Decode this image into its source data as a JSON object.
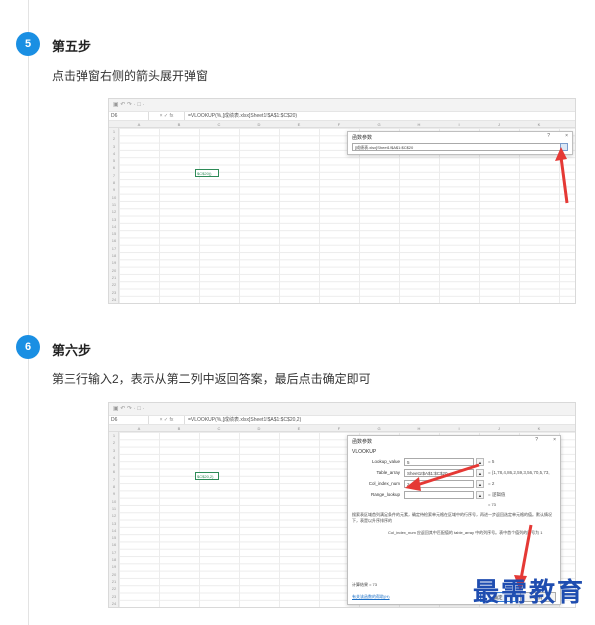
{
  "steps": [
    {
      "number": "5",
      "title": "第五步",
      "desc": "点击弹窗右侧的箭头展开弹窗"
    },
    {
      "number": "6",
      "title": "第六步",
      "desc": "第三行输入2，表示从第二列中返回答案，最后点击确定即可"
    }
  ],
  "shot1": {
    "qat": "▣ ↶ ↷ · □ ·",
    "name_box": "D6",
    "fx": "×  ✓  fx",
    "formula": "=VLOOKUP(%,[成绩表.xlsx]Sheet1!$A$1:$C$20)",
    "columns": [
      "A",
      "B",
      "C",
      "D",
      "E",
      "F",
      "G",
      "H",
      "I",
      "J",
      "K"
    ],
    "cell_ref": "$C$20))",
    "dialog_title": "函数参数",
    "dialog_help": "?",
    "dialog_close": "×",
    "dialog_input": "[成绩表.xlsx]Sheet1!$A$1:$C$20"
  },
  "shot2": {
    "qat": "▣ ↶ ↷ · □ ·",
    "name_box": "D6",
    "fx": "×  ✓  fx",
    "formula": "=VLOOKUP(%,[成绩表.xlsx]Sheet1!$A$1:$C$20,2)",
    "columns": [
      "A",
      "B",
      "C",
      "D",
      "E",
      "F",
      "G",
      "H",
      "I",
      "J",
      "K"
    ],
    "cell_ref": "$C$20,2)",
    "dialog_title": "函数参数",
    "dialog_help": "?",
    "dialog_close": "×",
    "function_name": "VLOOKUP",
    "args": [
      {
        "label": "Lookup_value",
        "value": "5",
        "result": "= 5"
      },
      {
        "label": "Table_array",
        "value": "Sheet1!$A$1:$C$20",
        "result": "= {1,78,4,86,2,59,3,56,70,5,73,"
      },
      {
        "label": "Col_index_num",
        "value": "2",
        "result": "= 2"
      },
      {
        "label": "Range_lookup",
        "value": "",
        "result": "= 逻辑值"
      }
    ],
    "result_line": "= 73",
    "description": "搜索表区域首列满足条件的元素，确定待检索单元格在区域中的行序号，再进一步返回选定单元格的值。默认情况下，表是以升序排序的",
    "arg_help": "Col_index_num  应返回其中匹配值的 table_array 中的列序号。表中首个值列的序号为 1",
    "calc_result": "计算结果 = 73",
    "help_link": "有关该函数的帮助(H)",
    "ok": "确定",
    "cancel": "取消"
  },
  "rows": [
    "1",
    "2",
    "3",
    "4",
    "5",
    "6",
    "7",
    "8",
    "9",
    "10",
    "11",
    "12",
    "13",
    "14",
    "15",
    "16",
    "17",
    "18",
    "19",
    "20",
    "21",
    "22",
    "23",
    "24"
  ],
  "watermark": "最需教育",
  "colors": {
    "accent": "#1a8fe3",
    "arrow": "#e53935",
    "watermark": "#1f4db0"
  }
}
